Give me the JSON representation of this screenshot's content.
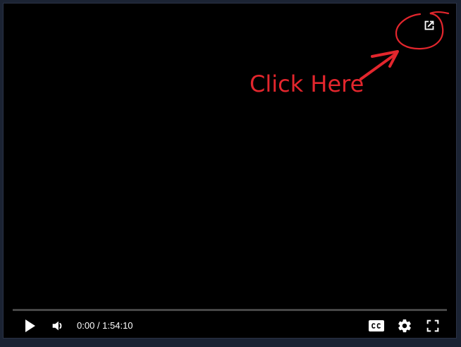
{
  "annotation": {
    "text": "Click Here",
    "color": "#e3262d"
  },
  "player": {
    "time": {
      "current": "0:00",
      "separator": " / ",
      "duration": "1:54:10"
    },
    "progress": 0,
    "accent_color": "#ff0000",
    "controls": {
      "play": "play-icon",
      "volume": "volume-icon",
      "captions": "cc-icon",
      "settings": "gear-icon",
      "fullscreen": "fullscreen-icon",
      "popout": "open-external-icon"
    }
  }
}
